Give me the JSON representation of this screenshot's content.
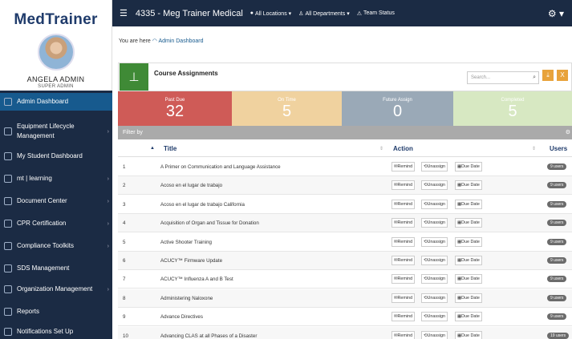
{
  "app": {
    "logo": "MedTrainer"
  },
  "user": {
    "name": "ANGELA ADMIN",
    "role": "SUPER ADMIN"
  },
  "sidebar": {
    "items": [
      {
        "label": "Admin Dashboard",
        "active": true
      },
      {
        "label": "Equipment Lifecycle Management",
        "chevron": true
      },
      {
        "label": "My Student Dashboard"
      },
      {
        "label": "mt | learning",
        "chevron": true
      },
      {
        "label": "Document Center",
        "chevron": true
      },
      {
        "label": "CPR Certification",
        "chevron": true
      },
      {
        "label": "Compliance Toolkits",
        "chevron": true
      },
      {
        "label": "SDS Management"
      },
      {
        "label": "Organization Management",
        "chevron": true
      },
      {
        "label": "Reports"
      },
      {
        "label": "Notifications Set Up"
      }
    ]
  },
  "topbar": {
    "title": "4335 - Meg Trainer Medical",
    "locations": "All Locations ▾",
    "departments": "All Departments ▾",
    "team_status": "Team Status"
  },
  "breadcrumb": {
    "prefix": "You are here",
    "link": "Admin Dashboard"
  },
  "course_assignments": {
    "title": "Course Assignments",
    "search_placeholder": "Search..."
  },
  "stats": [
    {
      "label": "Past Due",
      "value": "32",
      "color": "#cf5b57"
    },
    {
      "label": "On Time",
      "value": "5",
      "color": "#f0d29f"
    },
    {
      "label": "Future Assign",
      "value": "0",
      "color": "#9aa9b7"
    },
    {
      "label": "Completed",
      "value": "5",
      "color": "#d7e8c2"
    }
  ],
  "filter_label": "Filter by",
  "table": {
    "columns": {
      "title": "Title",
      "action": "Action",
      "users": "Users"
    },
    "action_labels": {
      "remind": "Remind",
      "unassign": "Unassign",
      "due_date": "Due Date"
    },
    "rows": [
      {
        "n": "1",
        "title": "A Primer on Communication and Language Assistance",
        "users": "9 users"
      },
      {
        "n": "2",
        "title": "Acoso en el lugar de trabajo",
        "users": "9 users"
      },
      {
        "n": "3",
        "title": "Acoso en el lugar de trabajo California",
        "users": "9 users"
      },
      {
        "n": "4",
        "title": "Acquisition of Organ and Tissue for Donation",
        "users": "9 users"
      },
      {
        "n": "5",
        "title": "Active Shooter Training",
        "users": "9 users"
      },
      {
        "n": "6",
        "title": "ACUCY™ Firmware Update",
        "users": "9 users"
      },
      {
        "n": "7",
        "title": "ACUCY™ Influenza A and B Test",
        "users": "9 users"
      },
      {
        "n": "8",
        "title": "Administering Naloxone",
        "users": "9 users"
      },
      {
        "n": "9",
        "title": "Advance Directives",
        "users": "9 users"
      },
      {
        "n": "10",
        "title": "Advancing CLAS at all Phases of a Disaster",
        "users": "19 users"
      }
    ]
  }
}
